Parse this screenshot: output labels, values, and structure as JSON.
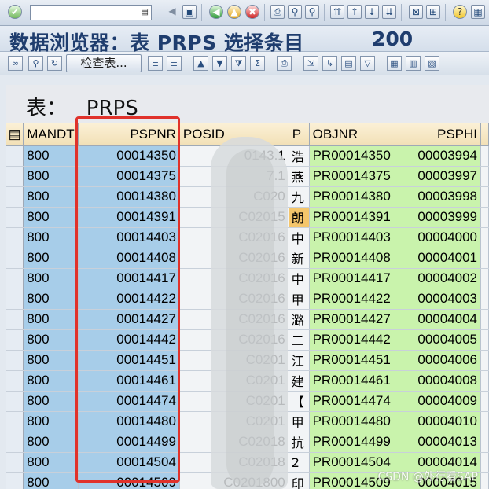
{
  "system_toolbar": {
    "command_field_value": "",
    "buttons": [
      "enter-icon",
      "save-icon",
      "back-icon",
      "exit-icon",
      "cancel-icon",
      "print-icon",
      "find-icon",
      "find-next-icon",
      "first-page-icon",
      "prev-page-icon",
      "next-page-icon",
      "last-page-icon",
      "new-session-icon",
      "shortcut-icon",
      "help-icon",
      "customize-icon"
    ]
  },
  "title": {
    "text": "数据浏览器：表 PRPS 选择条目",
    "count": "200"
  },
  "app_toolbar": {
    "check_table_label": "检查表..."
  },
  "table_label": "表：   PRPS",
  "columns": [
    "MANDT",
    "PSPNR",
    "POSID",
    "P",
    "OBJNR",
    "PSPHI"
  ],
  "rows": [
    {
      "mandt": "800",
      "pspnr": "00014350",
      "posid": "0143.1",
      "p": "浩",
      "objnr": "PR00014350",
      "psphi": "00003994"
    },
    {
      "mandt": "800",
      "pspnr": "00014375",
      "posid": "7.1",
      "p": "燕",
      "objnr": "PR00014375",
      "psphi": "00003997"
    },
    {
      "mandt": "800",
      "pspnr": "00014380",
      "posid": "C020",
      "p": "九",
      "objnr": "PR00014380",
      "psphi": "00003998"
    },
    {
      "mandt": "800",
      "pspnr": "00014391",
      "posid": "C02015",
      "p": "朗",
      "objnr": "PR00014391",
      "psphi": "00003999"
    },
    {
      "mandt": "800",
      "pspnr": "00014403",
      "posid": "C02016",
      "p": "中",
      "objnr": "PR00014403",
      "psphi": "00004000"
    },
    {
      "mandt": "800",
      "pspnr": "00014408",
      "posid": "C02016",
      "p": "新",
      "objnr": "PR00014408",
      "psphi": "00004001"
    },
    {
      "mandt": "800",
      "pspnr": "00014417",
      "posid": "C02016",
      "p": "中",
      "objnr": "PR00014417",
      "psphi": "00004002"
    },
    {
      "mandt": "800",
      "pspnr": "00014422",
      "posid": "C02016",
      "p": "甲",
      "objnr": "PR00014422",
      "psphi": "00004003"
    },
    {
      "mandt": "800",
      "pspnr": "00014427",
      "posid": "C02016",
      "p": "潞",
      "objnr": "PR00014427",
      "psphi": "00004004"
    },
    {
      "mandt": "800",
      "pspnr": "00014442",
      "posid": "C02016",
      "p": "二",
      "objnr": "PR00014442",
      "psphi": "00004005"
    },
    {
      "mandt": "800",
      "pspnr": "00014451",
      "posid": "C0201",
      "p": "江",
      "objnr": "PR00014451",
      "psphi": "00004006"
    },
    {
      "mandt": "800",
      "pspnr": "00014461",
      "posid": "C0201",
      "p": "建",
      "objnr": "PR00014461",
      "psphi": "00004008"
    },
    {
      "mandt": "800",
      "pspnr": "00014474",
      "posid": "C0201",
      "p": "【",
      "objnr": "PR00014474",
      "psphi": "00004009"
    },
    {
      "mandt": "800",
      "pspnr": "00014480",
      "posid": "C0201",
      "p": "甲",
      "objnr": "PR00014480",
      "psphi": "00004010"
    },
    {
      "mandt": "800",
      "pspnr": "00014499",
      "posid": "C02018",
      "p": "抗",
      "objnr": "PR00014499",
      "psphi": "00004013"
    },
    {
      "mandt": "800",
      "pspnr": "00014504",
      "posid": "C02018",
      "p": "2",
      "objnr": "PR00014504",
      "psphi": "00004014"
    },
    {
      "mandt": "800",
      "pspnr": "00014509",
      "posid": "C0201800",
      "p": "印",
      "objnr": "PR00014509",
      "psphi": "00004015"
    }
  ],
  "highlighted_row_index": 3,
  "watermark": "CSDN @外行看SAP",
  "colors": {
    "key_column": "#a7cde9",
    "green_column": "#c9f3ac",
    "header": "#f2e0b6",
    "highlight": "#f5c66b",
    "frame": "#e0322b"
  }
}
